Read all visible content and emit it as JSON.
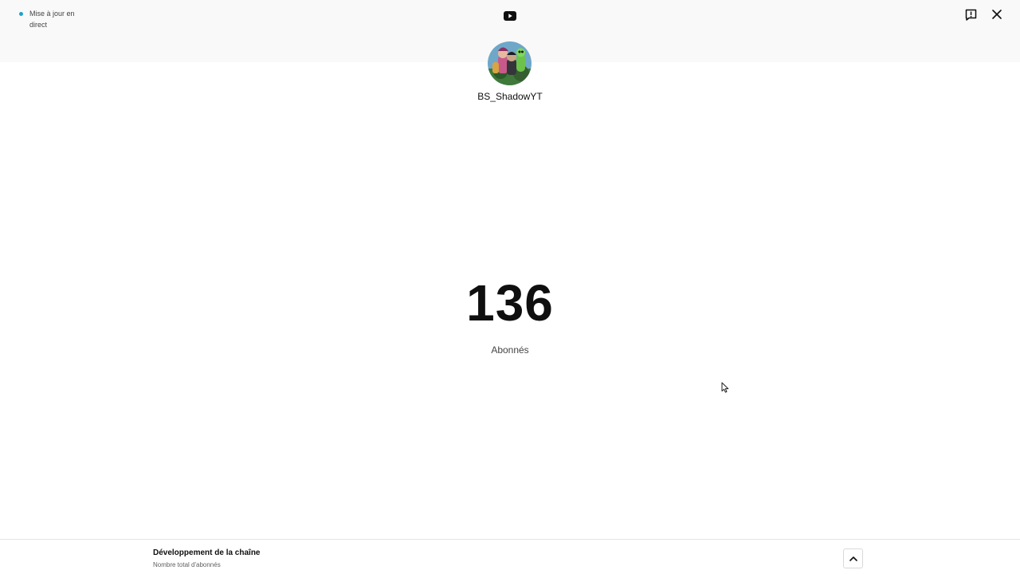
{
  "header": {
    "live_status": "Mise à jour en direct",
    "logo_icon": "youtube-logo-icon",
    "feedback_icon": "feedback-icon",
    "close_icon": "close-icon"
  },
  "channel": {
    "name": "BS_ShadowYT",
    "avatar_icon": "channel-avatar"
  },
  "stats": {
    "count": "136",
    "label": "Abonnés"
  },
  "bottom_panel": {
    "title": "Développement de la chaîne",
    "subtitle": "Nombre total d'abonnés",
    "expand_icon": "chevron-up-icon"
  },
  "colors": {
    "live_dot": "#1ea2c8",
    "youtube_red": "#0f0f0f",
    "header_bg": "#f9f9f9"
  }
}
